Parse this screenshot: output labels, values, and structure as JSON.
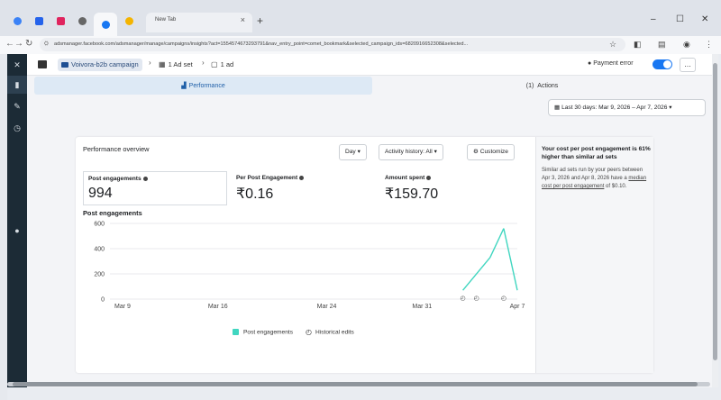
{
  "browser": {
    "new_tab_label": "New Tab",
    "url": "adsmanager.facebook.com/adsmanager/manage/campaigns/insights?act=1554574673293791&nav_entry_point=comet_bookmark&selected_campaign_ids=6820916652308&selected...",
    "icons": [
      "back-icon",
      "forward-icon",
      "reload-icon",
      "star-icon",
      "extensions-icon",
      "profile-icon",
      "menu-icon"
    ]
  },
  "header": {
    "campaign": "Voivora-b2b campaign",
    "adset": "1 Ad set",
    "ad": "1 ad",
    "payment_status": "Payment error"
  },
  "tabs": {
    "performance": "Performance",
    "actions_count": "(1)",
    "actions": "Actions"
  },
  "date_range": "Last 30 days: Mar 9, 2026 – Apr 7, 2026",
  "card": {
    "title": "Performance overview",
    "period": "Day",
    "activity": "Activity history: All",
    "customize": "Customize",
    "metrics": [
      {
        "label": "Post engagements",
        "value": "994"
      },
      {
        "label": "Per Post Engagement",
        "value": "₹0.16"
      },
      {
        "label": "Amount spent",
        "value": "₹159.70"
      }
    ],
    "chart_title": "Post engagements",
    "legend_series": "Post engagements",
    "legend_hist": "Historical edits"
  },
  "side": {
    "headline": "Your cost per post engagement is 61% higher than similar ad sets",
    "body_1": "Similar ad sets run by your peers between Apr 3, 2026 and Apr 8, 2026 have a ",
    "body_link": "median cost per post engagement",
    "body_2": " of $0.10."
  },
  "colors": {
    "accent": "#1877f2",
    "series": "#40d6c0",
    "sidebar": "#1c2b36"
  },
  "chart_data": {
    "type": "line",
    "categories": [
      "Mar 9",
      "Mar 16",
      "Mar 24",
      "Mar 31",
      "Apr 7"
    ],
    "y_ticks": [
      0,
      200,
      400,
      600
    ],
    "ylim": [
      0,
      600
    ],
    "series": [
      {
        "name": "Post engagements",
        "x_dates": [
          "Apr 3",
          "Apr 5",
          "Apr 6",
          "Apr 7"
        ],
        "values": [
          70,
          330,
          560,
          70
        ]
      }
    ],
    "historical_edit_dates": [
      "Apr 3",
      "Apr 4",
      "Apr 6"
    ],
    "grid": true
  }
}
